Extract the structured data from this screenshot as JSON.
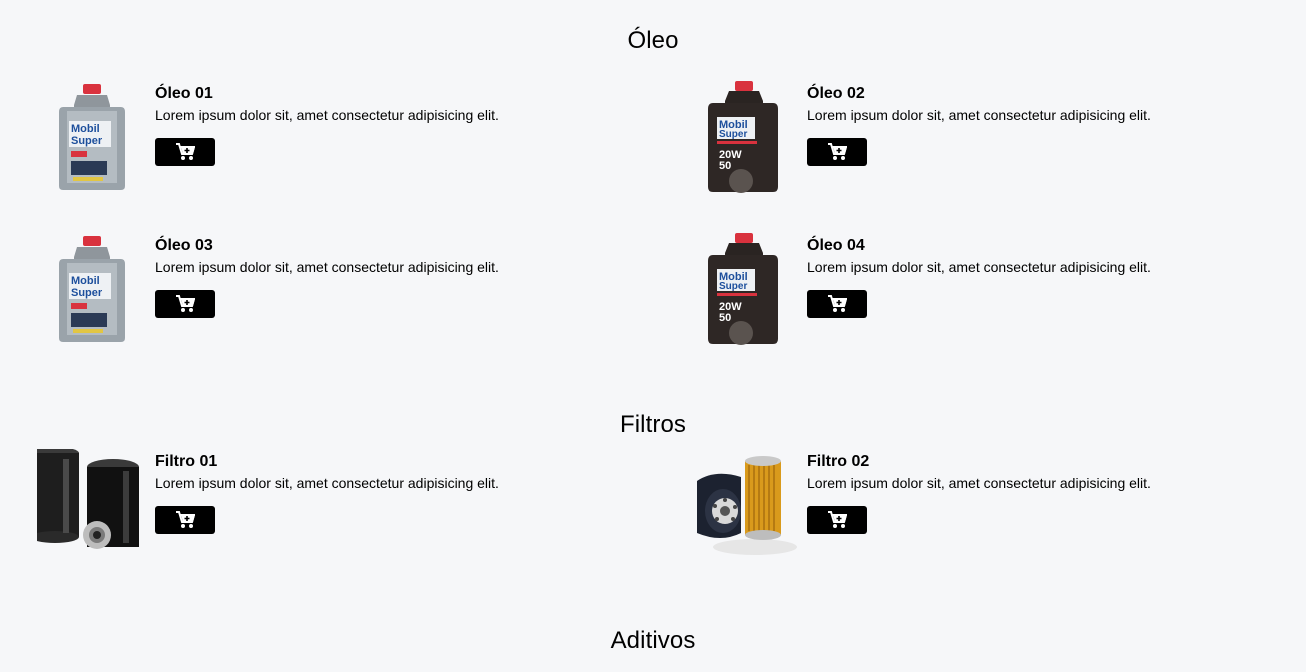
{
  "sections": [
    {
      "title": "Óleo",
      "products": [
        {
          "name": "Óleo 01",
          "description": "Lorem ipsum dolor sit, amet consectetur adipisicing elit.",
          "image_icon": "oil-bottle-gray-icon"
        },
        {
          "name": "Óleo 02",
          "description": "Lorem ipsum dolor sit, amet consectetur adipisicing elit.",
          "image_icon": "oil-bottle-black-icon"
        },
        {
          "name": "Óleo 03",
          "description": "Lorem ipsum dolor sit, amet consectetur adipisicing elit.",
          "image_icon": "oil-bottle-gray-icon"
        },
        {
          "name": "Óleo 04",
          "description": "Lorem ipsum dolor sit, amet consectetur adipisicing elit.",
          "image_icon": "oil-bottle-black-icon"
        }
      ]
    },
    {
      "title": "Filtros",
      "products": [
        {
          "name": "Filtro 01",
          "description": "Lorem ipsum dolor sit, amet consectetur adipisicing elit.",
          "image_icon": "oil-filter-black-icon"
        },
        {
          "name": "Filtro 02",
          "description": "Lorem ipsum dolor sit, amet consectetur adipisicing elit.",
          "image_icon": "oil-filter-yellow-icon"
        }
      ]
    },
    {
      "title": "Aditivos",
      "products": []
    }
  ],
  "bottle_brand": "Mobil",
  "bottle_line": "Super",
  "bottle_grade": "20W\n50",
  "colors": {
    "background": "#f6f7f9",
    "button": "#000000",
    "cap": "#d9323e"
  }
}
